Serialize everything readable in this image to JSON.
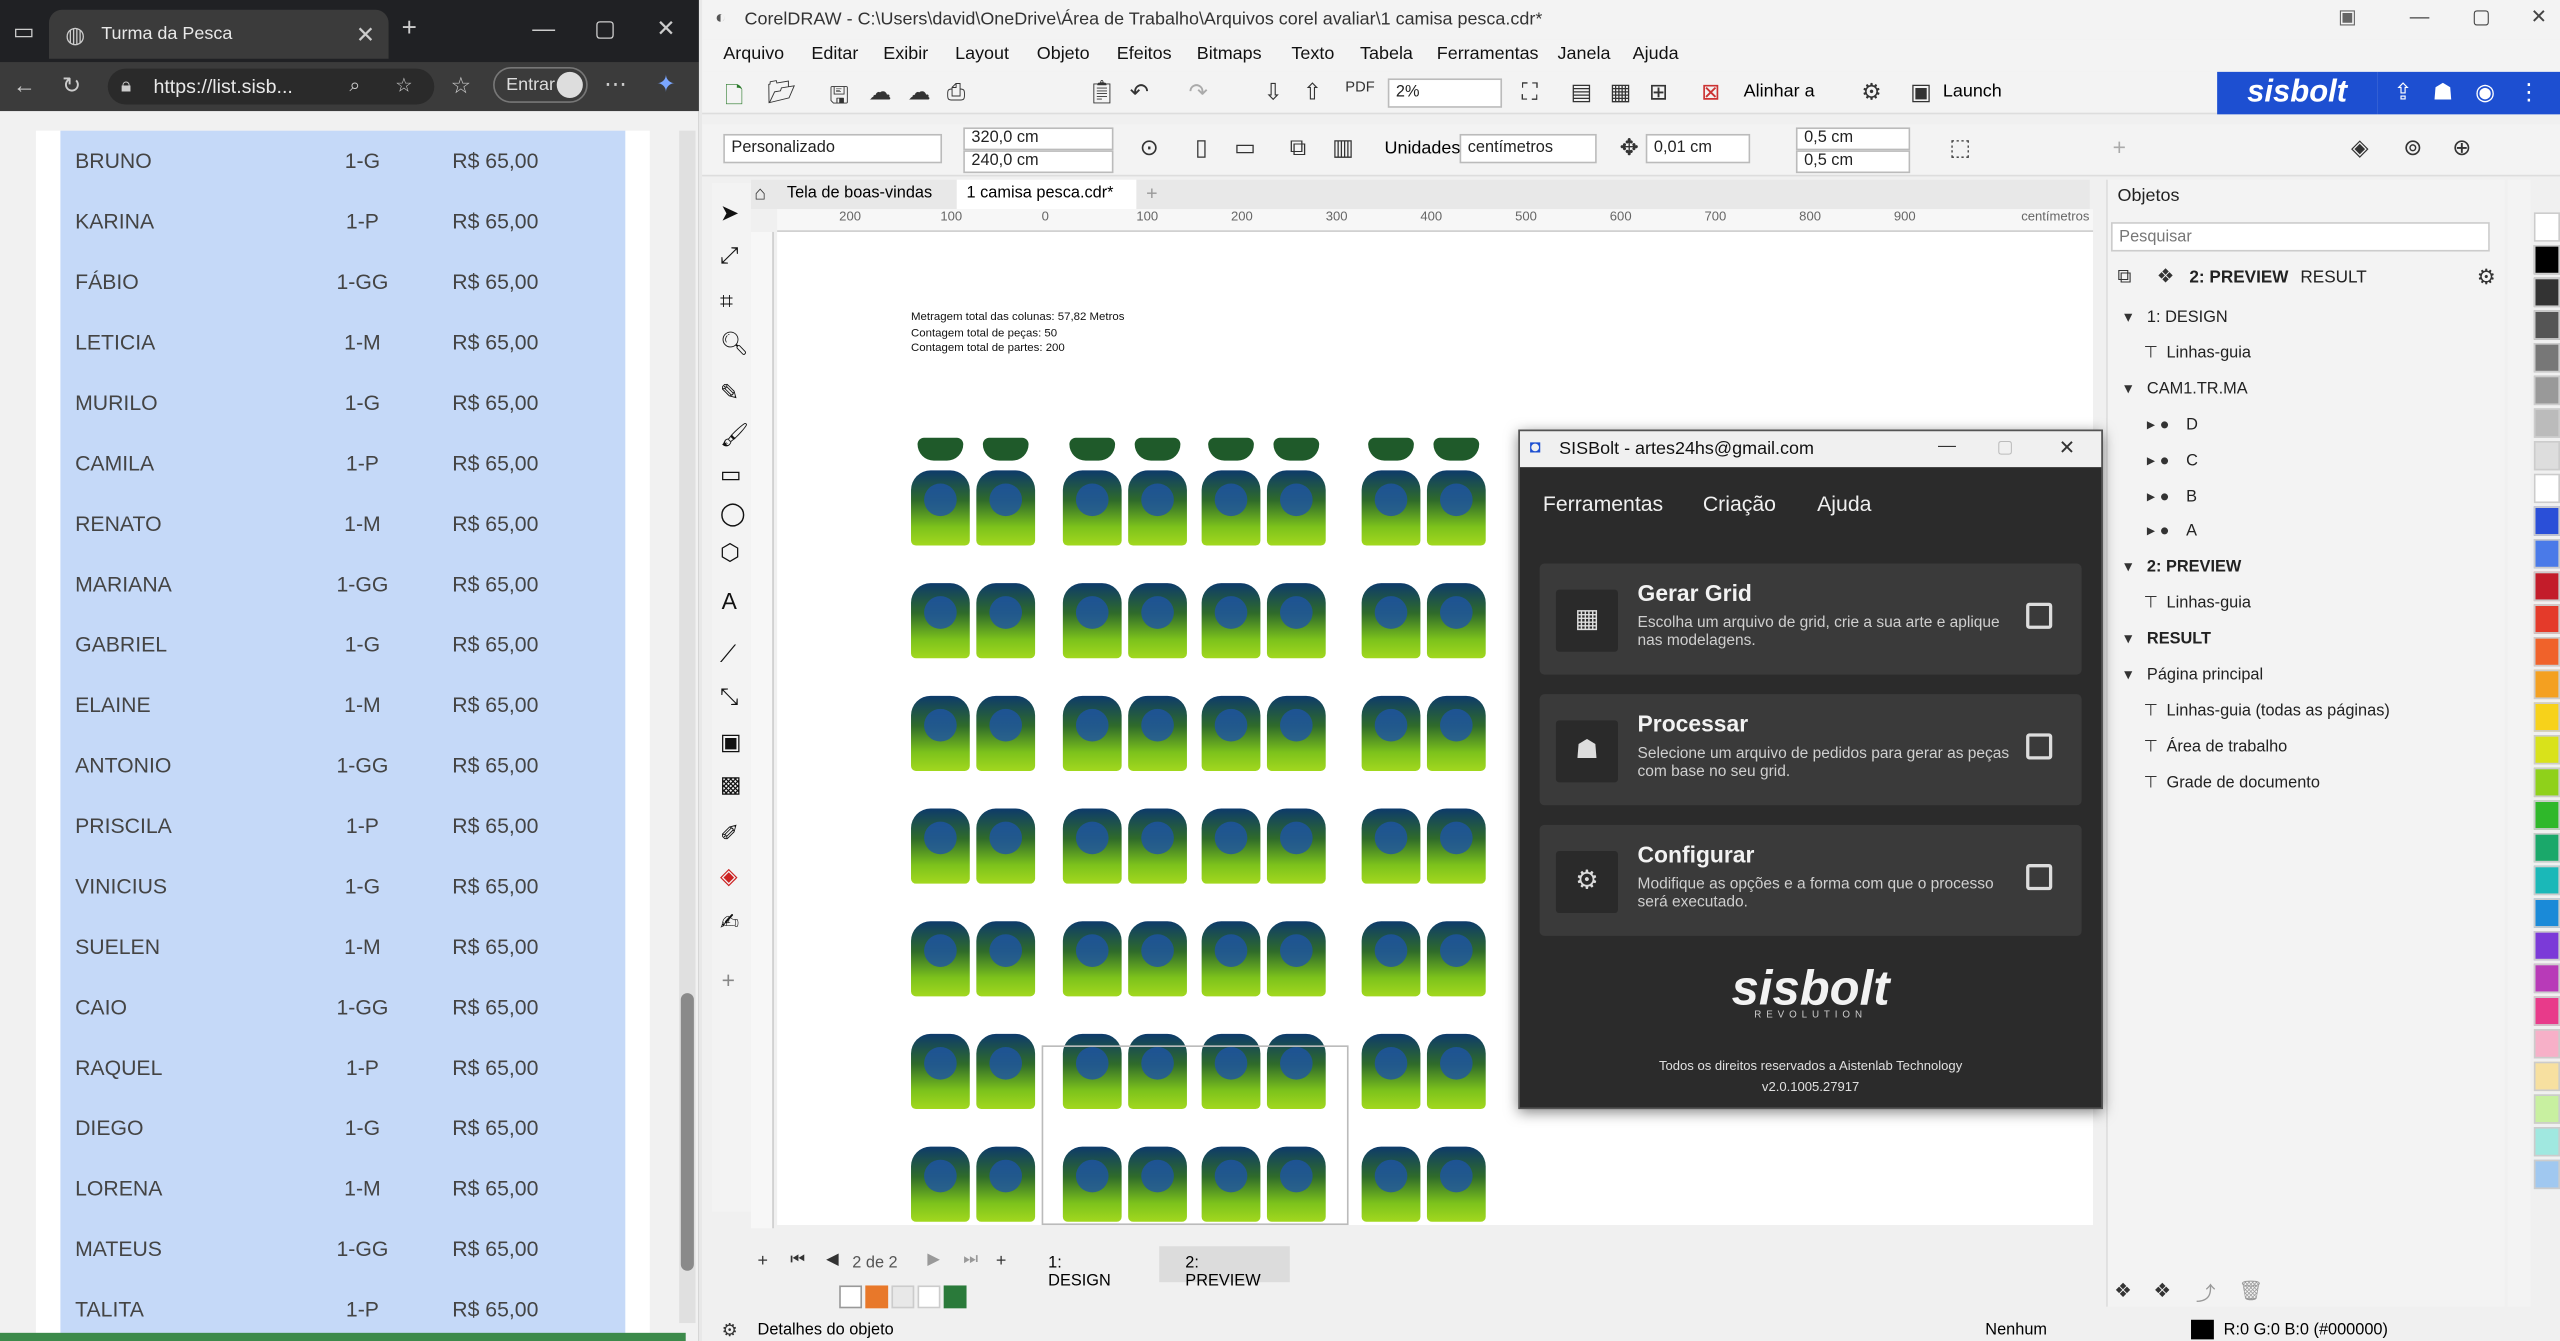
{
  "browser": {
    "tab_title": "Turma da Pesca",
    "url": "https://list.sisb...",
    "signin_label": "Entrar",
    "rows": [
      {
        "name": "BRUNO",
        "qty_size": "1-G",
        "price": "R$ 65,00"
      },
      {
        "name": "KARINA",
        "qty_size": "1-P",
        "price": "R$ 65,00"
      },
      {
        "name": "FÁBIO",
        "qty_size": "1-GG",
        "price": "R$ 65,00"
      },
      {
        "name": "LETICIA",
        "qty_size": "1-M",
        "price": "R$ 65,00"
      },
      {
        "name": "MURILO",
        "qty_size": "1-G",
        "price": "R$ 65,00"
      },
      {
        "name": "CAMILA",
        "qty_size": "1-P",
        "price": "R$ 65,00"
      },
      {
        "name": "RENATO",
        "qty_size": "1-M",
        "price": "R$ 65,00"
      },
      {
        "name": "MARIANA",
        "qty_size": "1-GG",
        "price": "R$ 65,00"
      },
      {
        "name": "GABRIEL",
        "qty_size": "1-G",
        "price": "R$ 65,00"
      },
      {
        "name": "ELAINE",
        "qty_size": "1-M",
        "price": "R$ 65,00"
      },
      {
        "name": "ANTONIO",
        "qty_size": "1-GG",
        "price": "R$ 65,00"
      },
      {
        "name": "PRISCILA",
        "qty_size": "1-P",
        "price": "R$ 65,00"
      },
      {
        "name": "VINICIUS",
        "qty_size": "1-G",
        "price": "R$ 65,00"
      },
      {
        "name": "SUELEN",
        "qty_size": "1-M",
        "price": "R$ 65,00"
      },
      {
        "name": "CAIO",
        "qty_size": "1-GG",
        "price": "R$ 65,00"
      },
      {
        "name": "RAQUEL",
        "qty_size": "1-P",
        "price": "R$ 65,00"
      },
      {
        "name": "DIEGO",
        "qty_size": "1-G",
        "price": "R$ 65,00"
      },
      {
        "name": "LORENA",
        "qty_size": "1-M",
        "price": "R$ 65,00"
      },
      {
        "name": "MATEUS",
        "qty_size": "1-GG",
        "price": "R$ 65,00"
      },
      {
        "name": "TALITA",
        "qty_size": "1-P",
        "price": "R$ 65,00"
      }
    ]
  },
  "corel": {
    "window_title": "CorelDRAW - C:\\Users\\david\\OneDrive\\Área de Trabalho\\Arquivos corel avaliar\\1 camisa pesca.cdr*",
    "menu": [
      "Arquivo",
      "Editar",
      "Exibir",
      "Layout",
      "Objeto",
      "Efeitos",
      "Bitmaps",
      "Texto",
      "Tabela",
      "Ferramentas",
      "Janela",
      "Ajuda"
    ],
    "zoom": "2%",
    "align_label": "Alinhar a",
    "launch_label": "Launch",
    "page_preset": "Personalizado",
    "width": "320,0 cm",
    "height": "240,0 cm",
    "units_label": "Unidades:",
    "units_value": "centímetros",
    "nudge": "0,01 cm",
    "dup_x": "0,5 cm",
    "dup_y": "0,5 cm",
    "doc_tabs": [
      "Tela de boas-vindas",
      "1 camisa pesca.cdr*"
    ],
    "ruler_ticks": [
      "200",
      "100",
      "0",
      "100",
      "200",
      "300",
      "400",
      "500",
      "600",
      "700",
      "800",
      "900"
    ],
    "ruler_unit": "centímetros",
    "canvas_text": [
      "Metragem total das colunas: 57,82 Metros",
      "Contagem total de peças: 50",
      "Contagem total de partes: 200"
    ],
    "page_nav": "2 de 2",
    "page_tabs": [
      "1: DESIGN",
      "2: PREVIEW"
    ],
    "status_left": "Detalhes do objeto",
    "fill_label": "Nenhum",
    "color_readout": "R:0 G:0 B:0 (#000000)",
    "brand": "sisbolt"
  },
  "objects": {
    "panel_title": "Objetos",
    "search_placeholder": "Pesquisar",
    "current_layer": "2: PREVIEW",
    "result_label": "RESULT",
    "tree": [
      {
        "label": "1: DESIGN",
        "level": 0,
        "bold": false
      },
      {
        "label": "Linhas-guia",
        "level": 1,
        "bold": false
      },
      {
        "label": "CAM1.TR.MA",
        "level": 0,
        "bold": false
      },
      {
        "label": "D",
        "level": 2,
        "bold": false
      },
      {
        "label": "C",
        "level": 2,
        "bold": false
      },
      {
        "label": "B",
        "level": 2,
        "bold": false
      },
      {
        "label": "A",
        "level": 2,
        "bold": false
      },
      {
        "label": "2: PREVIEW",
        "level": 0,
        "bold": true
      },
      {
        "label": "Linhas-guia",
        "level": 1,
        "bold": false
      },
      {
        "label": "RESULT",
        "level": 0,
        "bold": true
      },
      {
        "label": "Página principal",
        "level": 0,
        "bold": false
      },
      {
        "label": "Linhas-guia (todas as páginas)",
        "level": 1,
        "bold": false
      },
      {
        "label": "Área de trabalho",
        "level": 1,
        "bold": false
      },
      {
        "label": "Grade de documento",
        "level": 1,
        "bold": false
      }
    ]
  },
  "dialog": {
    "title": "SISBolt - artes24hs@gmail.com",
    "menu": [
      "Ferramentas",
      "Criação",
      "Ajuda"
    ],
    "cards": [
      {
        "title": "Gerar Grid",
        "desc": "Escolha um arquivo de grid, crie a sua arte e aplique nas modelagens."
      },
      {
        "title": "Processar",
        "desc": "Selecione um arquivo de pedidos para gerar as peças com base no seu grid."
      },
      {
        "title": "Configurar",
        "desc": "Modifique as opções e a forma com que o processo será executado."
      }
    ],
    "logo": "sisbolt",
    "logo_sub": "REVOLUTION",
    "footer": "Todos os direitos reservados a Aistenlab Technology",
    "version": "v2.0.1005.27917"
  },
  "colors": {
    "accent": "#1d4fd1",
    "list_bg": "#c5d9f8",
    "dialog_bg": "#2b2b2b"
  }
}
